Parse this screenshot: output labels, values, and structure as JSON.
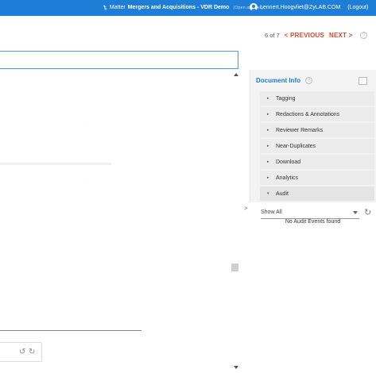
{
  "topbar": {
    "matter_prefix": "Matter",
    "matter_name": "Mergers and Acquisitions - VDR Demo",
    "open_another": "(Open another)",
    "user_email": "Lennert.Hoogvliet@ZyLAB.COM",
    "logout": "(Logout)",
    "color": "#1e7dd6"
  },
  "nav": {
    "position": "6 of 7",
    "previous": "< PREVIOUS",
    "next": "NEXT >",
    "accent": "#e0462e"
  },
  "panel": {
    "title": "Document Info",
    "sections": [
      {
        "label": "Tagging",
        "expanded": false
      },
      {
        "label": "Redactions & Annotations",
        "expanded": false
      },
      {
        "label": "Reviewer Remarks",
        "expanded": false
      },
      {
        "label": "Near-Duplicates",
        "expanded": false
      },
      {
        "label": "Download",
        "expanded": false
      },
      {
        "label": "Analytics",
        "expanded": false
      },
      {
        "label": "Audit",
        "expanded": true
      }
    ],
    "audit": {
      "filter_value": "Show All",
      "empty_message": "No Audit Events found"
    }
  },
  "icons": {
    "help": "?",
    "expand": ">",
    "section_collapsed": "▸",
    "section_expanded": "▾",
    "refresh": "↻",
    "rotate_left": "↺",
    "rotate_right": "↻"
  }
}
